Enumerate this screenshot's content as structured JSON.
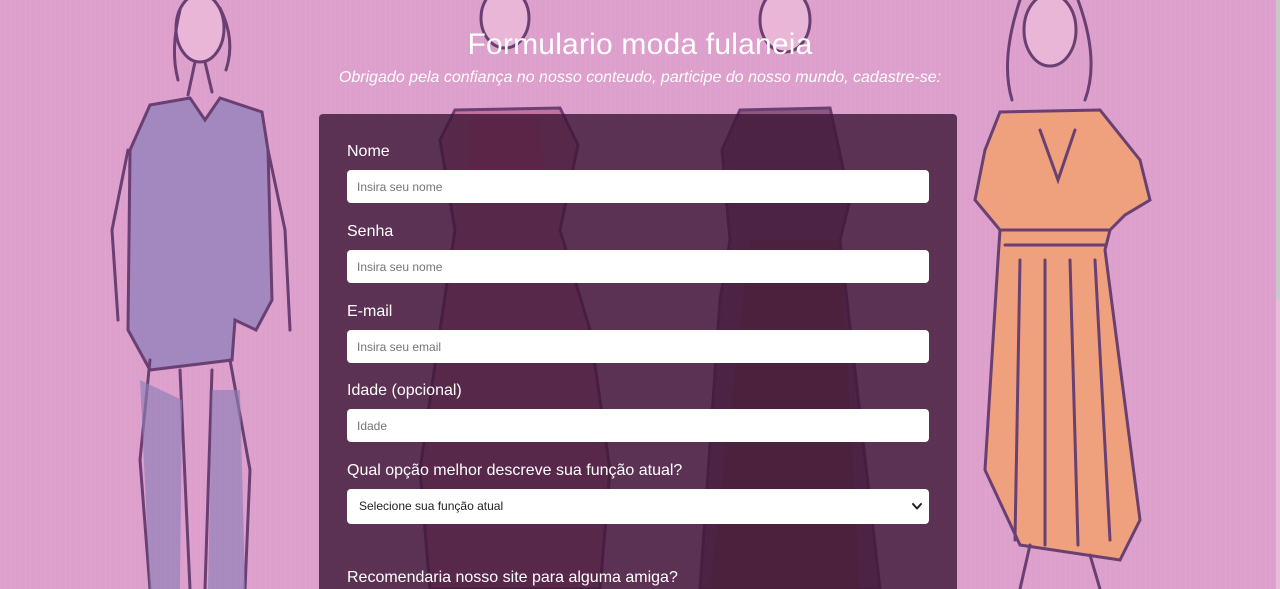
{
  "header": {
    "title": "Formulario moda fulaneia",
    "subtitle": "Obrigado pela confiança no nosso conteudo, participe do nosso mundo, cadastre-se:"
  },
  "form": {
    "fields": [
      {
        "label": "Nome",
        "placeholder": "Insira seu nome"
      },
      {
        "label": "Senha",
        "placeholder": "Insira seu nome"
      },
      {
        "label": "E-mail",
        "placeholder": "Insira seu email"
      },
      {
        "label": "Idade (opcional)",
        "placeholder": "Idade"
      }
    ],
    "role": {
      "label": "Qual opção melhor descreve sua função atual?",
      "selected": "Selecione sua função atual",
      "icon": "chevron-down-icon"
    },
    "recommend": {
      "label": "Recomendaria nosso site para alguma amiga?"
    }
  },
  "colors": {
    "background": "#dd9fcb",
    "panel": "#3c1636",
    "text": "#ffffff"
  }
}
